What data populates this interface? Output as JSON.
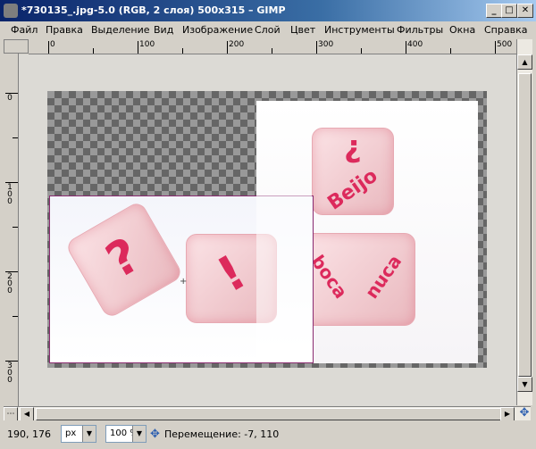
{
  "window": {
    "title": "*730135_.jpg-5.0 (RGB, 2 слоя) 500x315 – GIMP",
    "minimize": "_",
    "maximize": "□",
    "close": "✕"
  },
  "menu": [
    "Файл",
    "Правка",
    "Выделение",
    "Вид",
    "Изображение",
    "Слой",
    "Цвет",
    "Инструменты",
    "Фильтры",
    "Окна",
    "Справка"
  ],
  "ruler_h": {
    "labels": [
      "0",
      "100",
      "200",
      "300",
      "400",
      "500"
    ]
  },
  "ruler_v": {
    "labels": [
      "0",
      "100",
      "200",
      "300"
    ]
  },
  "canvas": {
    "dice_top_right": {
      "symbol": "?",
      "word": "Beijo"
    },
    "dice_bottom_right": {
      "left_word": "boca",
      "right_word": "nuca"
    },
    "dice_left": {
      "q": "?",
      "excl": "!"
    }
  },
  "status": {
    "coords": "190, 176",
    "unit": "px",
    "zoom": "100 %",
    "message": "Перемещение: -7, 110"
  },
  "icons": {
    "move": "move-cross-icon",
    "navigate": "navigate-icon"
  }
}
